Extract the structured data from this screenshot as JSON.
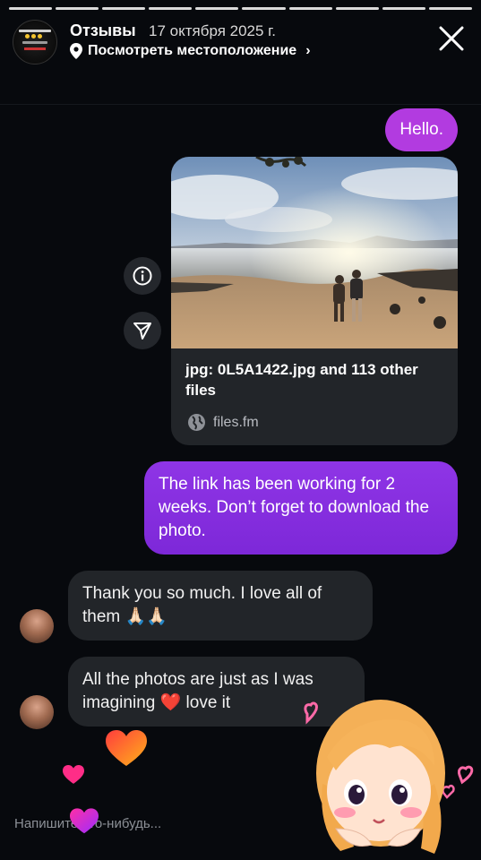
{
  "story": {
    "segments": 10,
    "title": "Отзывы",
    "date": "17 октября 2025 г.",
    "location_label": "Посмотреть местоположение",
    "chevron": "›"
  },
  "chat": {
    "hello": "Hello.",
    "file_card": {
      "name": "jpg: 0L5A1422.jpg and 113 other files",
      "site": "files.fm"
    },
    "link_message": "The link has been working for 2 weeks. Don’t forget to download the photo.",
    "thanks_message": "Thank you so much. I love all of them 🙏🏻🙏🏻",
    "imagine_message": "All the photos are just as I was imagining ❤️ love it"
  },
  "input": {
    "placeholder": "Напишите что-нибудь..."
  },
  "icons": [
    "close-icon",
    "location-pin-icon",
    "info-icon",
    "share-icon",
    "globe-icon"
  ],
  "colors": {
    "background": "#07090d",
    "my_bubble": "#8a2be2",
    "their_bubble": "#222529"
  }
}
